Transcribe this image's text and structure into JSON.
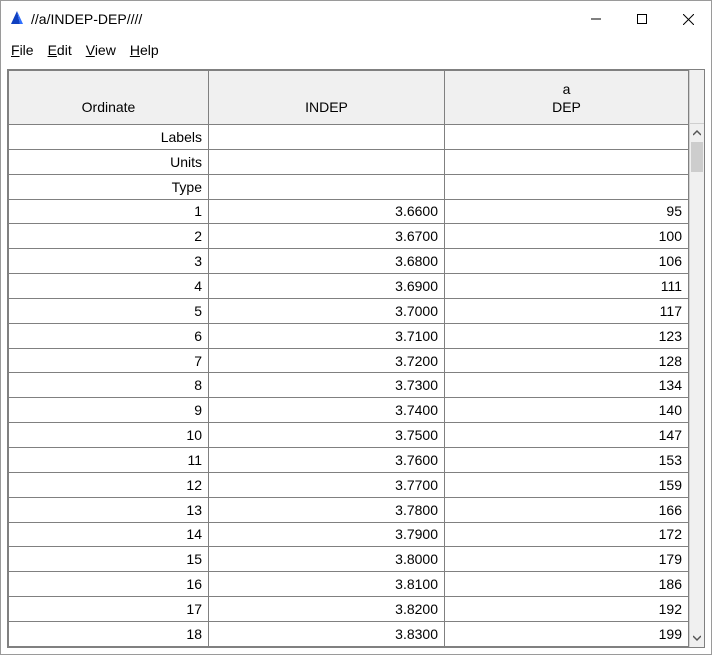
{
  "window": {
    "title": "//a/INDEP-DEP////"
  },
  "menubar": {
    "file": "File",
    "edit": "Edit",
    "view": "View",
    "help": "Help"
  },
  "columns": {
    "ordinate": "Ordinate",
    "indep": "INDEP",
    "dep_top": "a",
    "dep_bottom": "DEP"
  },
  "meta_rows": {
    "labels": "Labels",
    "units": "Units",
    "type": "Type"
  },
  "rows": [
    {
      "n": "1",
      "indep": "3.6600",
      "dep": "95"
    },
    {
      "n": "2",
      "indep": "3.6700",
      "dep": "100"
    },
    {
      "n": "3",
      "indep": "3.6800",
      "dep": "106"
    },
    {
      "n": "4",
      "indep": "3.6900",
      "dep": "111"
    },
    {
      "n": "5",
      "indep": "3.7000",
      "dep": "117"
    },
    {
      "n": "6",
      "indep": "3.7100",
      "dep": "123"
    },
    {
      "n": "7",
      "indep": "3.7200",
      "dep": "128"
    },
    {
      "n": "8",
      "indep": "3.7300",
      "dep": "134"
    },
    {
      "n": "9",
      "indep": "3.7400",
      "dep": "140"
    },
    {
      "n": "10",
      "indep": "3.7500",
      "dep": "147"
    },
    {
      "n": "11",
      "indep": "3.7600",
      "dep": "153"
    },
    {
      "n": "12",
      "indep": "3.7700",
      "dep": "159"
    },
    {
      "n": "13",
      "indep": "3.7800",
      "dep": "166"
    },
    {
      "n": "14",
      "indep": "3.7900",
      "dep": "172"
    },
    {
      "n": "15",
      "indep": "3.8000",
      "dep": "179"
    },
    {
      "n": "16",
      "indep": "3.8100",
      "dep": "186"
    },
    {
      "n": "17",
      "indep": "3.8200",
      "dep": "192"
    },
    {
      "n": "18",
      "indep": "3.8300",
      "dep": "199"
    }
  ]
}
